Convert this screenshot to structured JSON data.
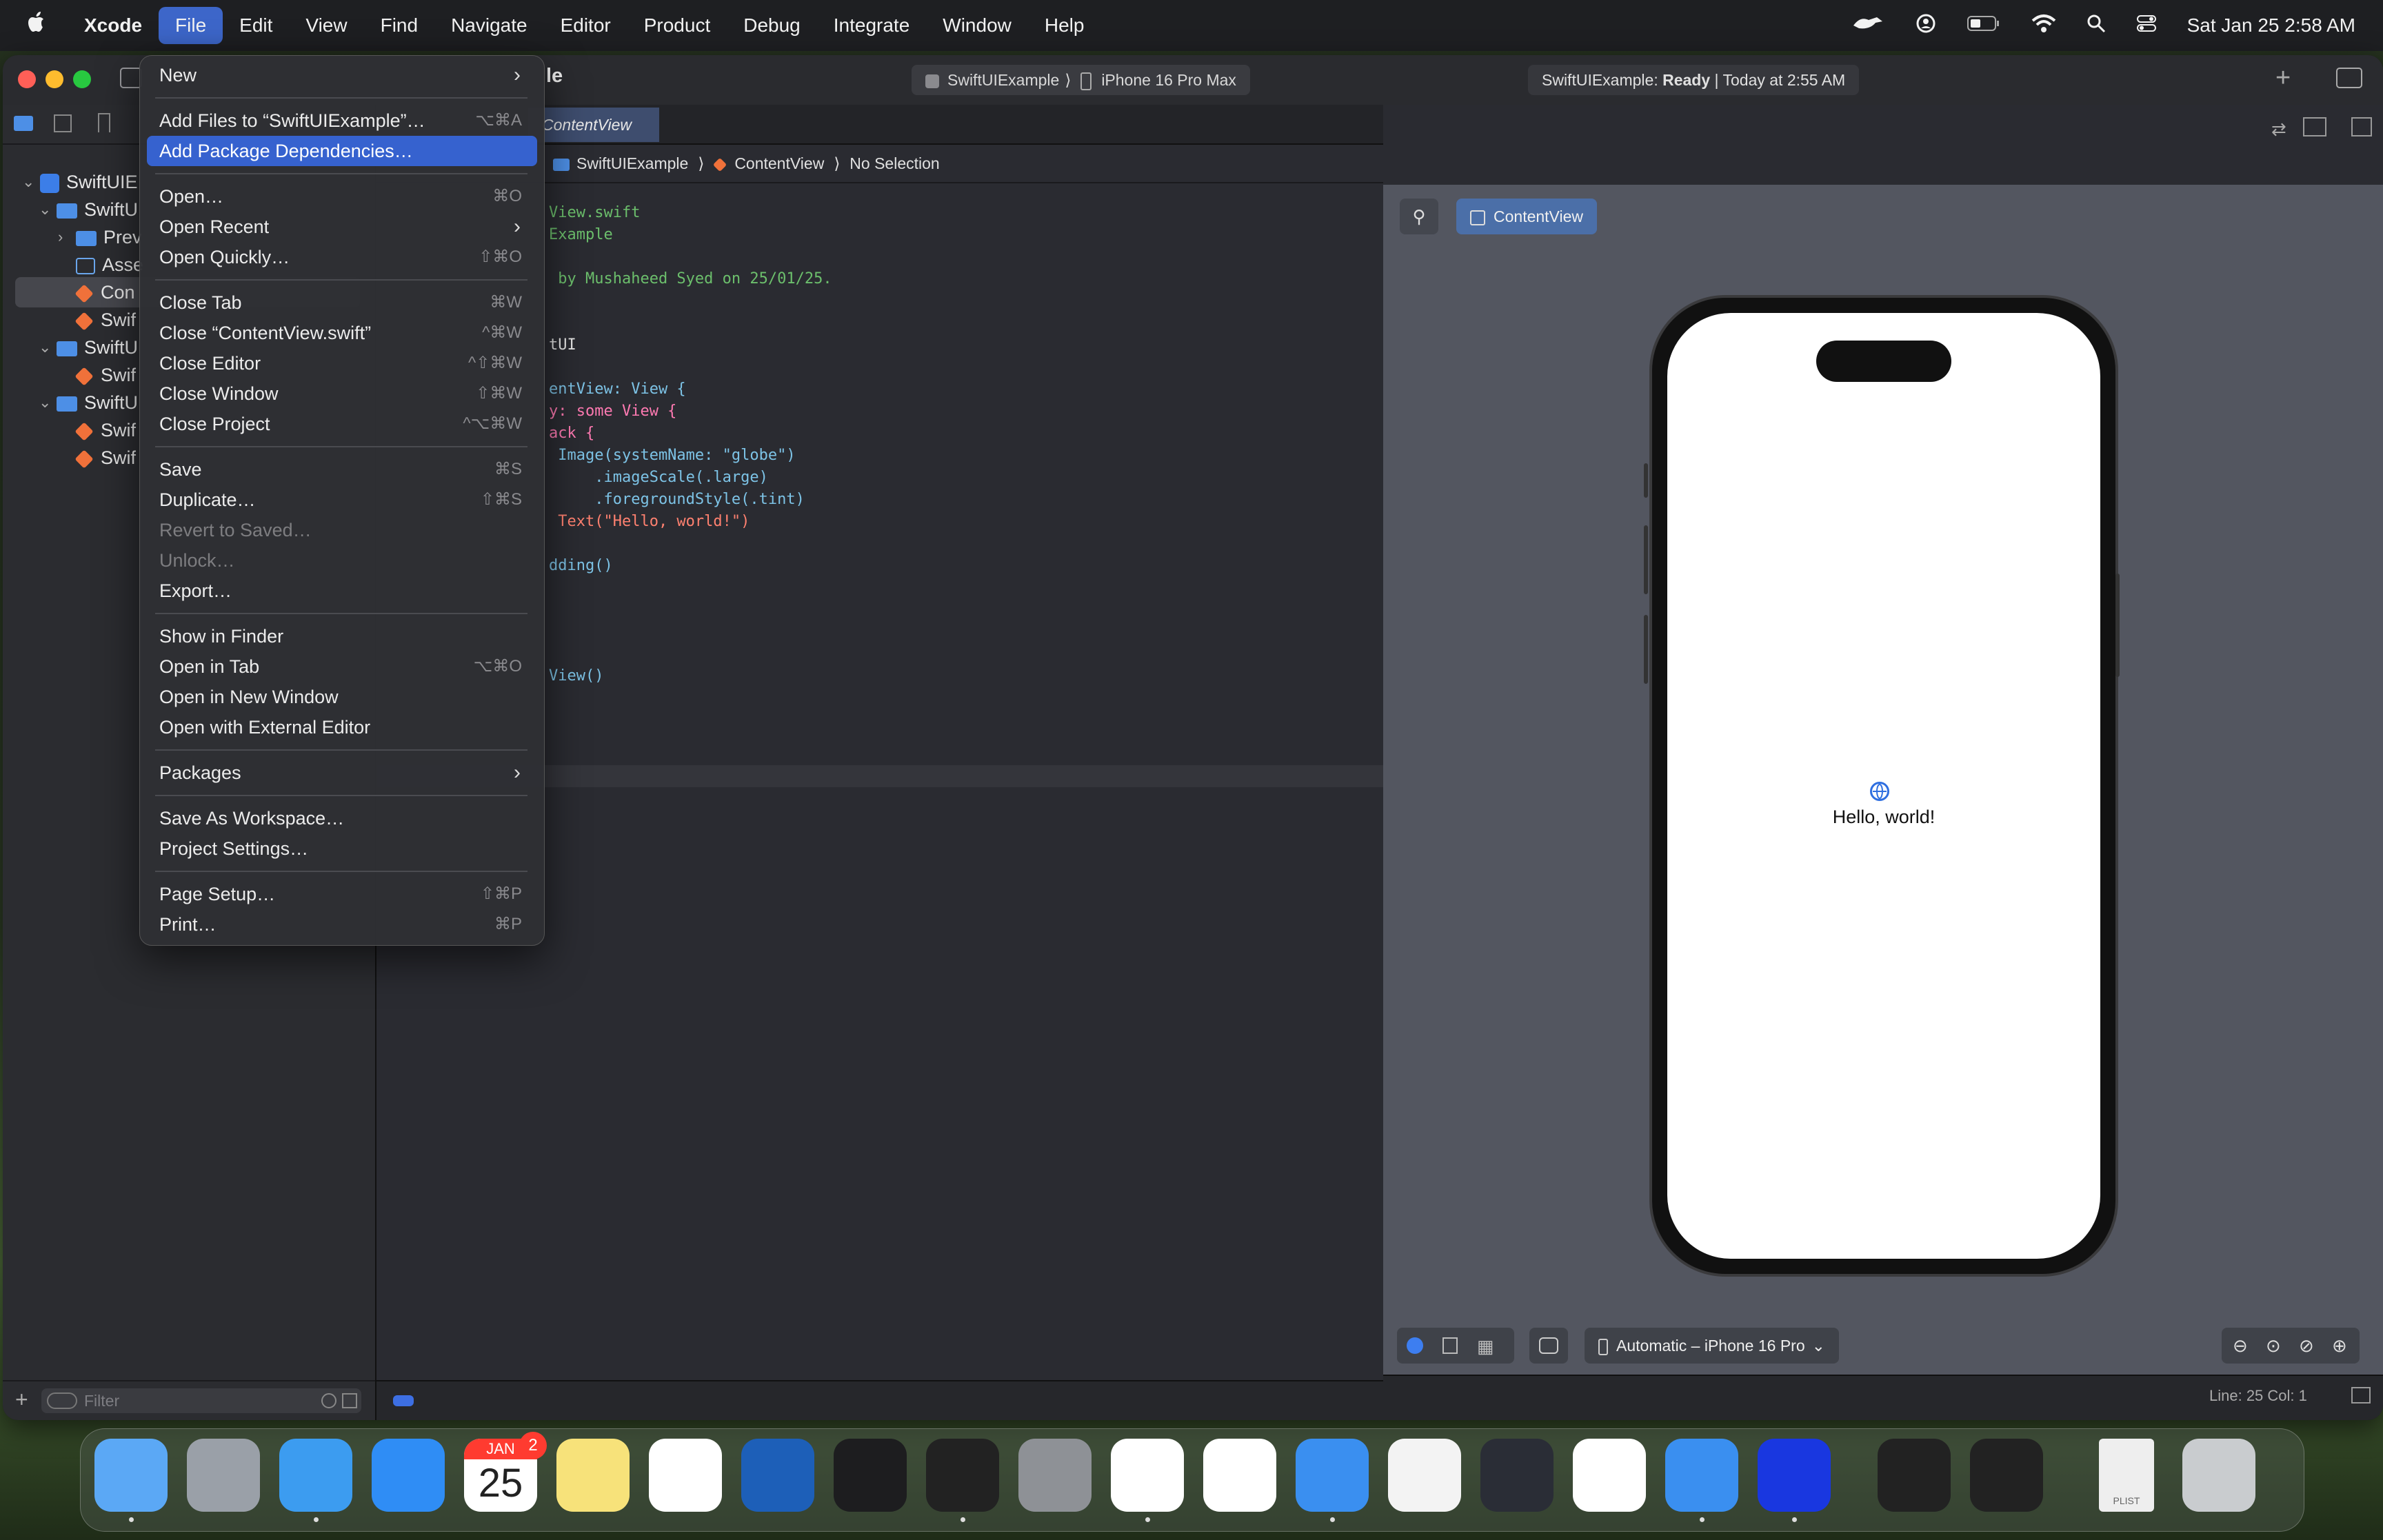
{
  "menubar": {
    "apple": "",
    "app": "Xcode",
    "items": [
      "File",
      "Edit",
      "View",
      "Find",
      "Navigate",
      "Editor",
      "Product",
      "Debug",
      "Integrate",
      "Window",
      "Help"
    ],
    "datetime": "Sat Jan 25  2:58 AM"
  },
  "toolbar": {
    "title_fragment": "le",
    "scheme": "SwiftUIExample",
    "device": "iPhone 16 Pro Max",
    "status_prefix": "SwiftUIExample:",
    "status_state": "Ready",
    "status_time": "| Today at 2:55 AM"
  },
  "editor": {
    "tab": "ContentView",
    "breadcrumb": [
      "SwiftUIExample",
      "ContentView",
      "No Selection"
    ],
    "code": [
      {
        "t": "View.swift",
        "c": "cm"
      },
      {
        "t": "Example",
        "c": "cm"
      },
      {
        "t": "",
        "c": "pl"
      },
      {
        "t": " by Mushaheed Syed on 25/01/25.",
        "c": "cm"
      },
      {
        "t": "",
        "c": "pl"
      },
      {
        "t": "",
        "c": "pl"
      },
      {
        "t": "tUI",
        "c": "pl"
      },
      {
        "t": "",
        "c": "pl"
      },
      {
        "t": "entView: View {",
        "c": "ty"
      },
      {
        "t": "y: some View {",
        "c": "kw"
      },
      {
        "t": "ack {",
        "c": "kw"
      },
      {
        "t": " Image(systemName: \"globe\")",
        "c": "ty"
      },
      {
        "t": "     .imageScale(.large)",
        "c": "ty"
      },
      {
        "t": "     .foregroundStyle(.tint)",
        "c": "ty"
      },
      {
        "t": " Text(\"Hello, world!\")",
        "c": "st"
      },
      {
        "t": "",
        "c": "pl"
      },
      {
        "t": "dding()",
        "c": "ty"
      },
      {
        "t": "",
        "c": "pl"
      },
      {
        "t": "",
        "c": "pl"
      },
      {
        "t": "",
        "c": "pl"
      },
      {
        "t": "",
        "c": "pl"
      },
      {
        "t": "View()",
        "c": "ty"
      }
    ],
    "status_line": "Line: 25  Col: 1"
  },
  "navigator": {
    "items": [
      {
        "label": "SwiftUIE",
        "kind": "project"
      },
      {
        "label": "SwiftU",
        "kind": "folder"
      },
      {
        "label": "Prev",
        "kind": "folder"
      },
      {
        "label": "Asse",
        "kind": "assets"
      },
      {
        "label": "Con",
        "kind": "swift"
      },
      {
        "label": "Swif",
        "kind": "swift"
      },
      {
        "label": "SwiftU",
        "kind": "folder"
      },
      {
        "label": "Swif",
        "kind": "swift"
      },
      {
        "label": "SwiftU",
        "kind": "folder"
      },
      {
        "label": "Swif",
        "kind": "swift"
      },
      {
        "label": "Swif",
        "kind": "swift"
      }
    ],
    "filter_placeholder": "Filter"
  },
  "file_menu": {
    "groups": [
      [
        {
          "label": "New",
          "shortcut": "",
          "submenu": true
        }
      ],
      [
        {
          "label": "Add Files to “SwiftUIExample”…",
          "shortcut": "⌥⌘A"
        },
        {
          "label": "Add Package Dependencies…",
          "shortcut": "",
          "highlighted": true
        }
      ],
      [
        {
          "label": "Open…",
          "shortcut": "⌘O"
        },
        {
          "label": "Open Recent",
          "shortcut": "",
          "submenu": true
        },
        {
          "label": "Open Quickly…",
          "shortcut": "⇧⌘O"
        }
      ],
      [
        {
          "label": "Close Tab",
          "shortcut": "⌘W"
        },
        {
          "label": "Close “ContentView.swift”",
          "shortcut": "^⌘W"
        },
        {
          "label": "Close Editor",
          "shortcut": "^⇧⌘W"
        },
        {
          "label": "Close Window",
          "shortcut": "⇧⌘W"
        },
        {
          "label": "Close Project",
          "shortcut": "^⌥⌘W"
        }
      ],
      [
        {
          "label": "Save",
          "shortcut": "⌘S"
        },
        {
          "label": "Duplicate…",
          "shortcut": "⇧⌘S"
        },
        {
          "label": "Revert to Saved…",
          "shortcut": "",
          "disabled": true
        },
        {
          "label": "Unlock…",
          "shortcut": "",
          "disabled": true
        },
        {
          "label": "Export…",
          "shortcut": ""
        }
      ],
      [
        {
          "label": "Show in Finder",
          "shortcut": ""
        },
        {
          "label": "Open in Tab",
          "shortcut": "⌥⌘O"
        },
        {
          "label": "Open in New Window",
          "shortcut": ""
        },
        {
          "label": "Open with External Editor",
          "shortcut": ""
        }
      ],
      [
        {
          "label": "Packages",
          "shortcut": "",
          "submenu": true
        }
      ],
      [
        {
          "label": "Save As Workspace…",
          "shortcut": ""
        },
        {
          "label": "Project Settings…",
          "shortcut": ""
        }
      ],
      [
        {
          "label": "Page Setup…",
          "shortcut": "⇧⌘P"
        },
        {
          "label": "Print…",
          "shortcut": "⌘P"
        }
      ]
    ]
  },
  "preview": {
    "tab_label": "ContentView",
    "hello_text": "Hello, world!",
    "device_selector": "Automatic – iPhone 16 Pro"
  },
  "dock": {
    "calendar_month": "JAN",
    "calendar_day": "25",
    "calendar_badge": "2",
    "plist_label": "PLIST",
    "apps": [
      {
        "name": "finder-icon",
        "color": "#5ba8f5"
      },
      {
        "name": "launchpad-icon",
        "color": "#9aa0a8"
      },
      {
        "name": "safari-icon",
        "color": "#3c9cf0"
      },
      {
        "name": "app-store-icon",
        "color": "#2f8df5"
      },
      {
        "name": "calendar-icon",
        "color": "#ffffff"
      },
      {
        "name": "notes-icon",
        "color": "#f7e27a"
      },
      {
        "name": "gmail-icon",
        "color": "#ffffff"
      },
      {
        "name": "windows-app-icon",
        "color": "#1d5fb8"
      },
      {
        "name": "terminal-icon",
        "color": "#1d1d1f"
      },
      {
        "name": "unity-icon",
        "color": "#222222"
      },
      {
        "name": "system-settings-icon",
        "color": "#8e9196"
      },
      {
        "name": "slack-icon",
        "color": "#ffffff"
      },
      {
        "name": "chrome-icon",
        "color": "#ffffff"
      },
      {
        "name": "xcode-icon",
        "color": "#3a8ff0"
      },
      {
        "name": "instruments-icon",
        "color": "#f3f3f3"
      },
      {
        "name": "nox-icon",
        "color": "#2a2d36"
      },
      {
        "name": "vscode-icon",
        "color": "#ffffff"
      },
      {
        "name": "xcode-alt-icon",
        "color": "#3a8ff0"
      },
      {
        "name": "proxyman-icon",
        "color": "#1937e0"
      },
      {
        "name": "unity-hub-icon",
        "color": "#222222"
      },
      {
        "name": "unity-hub-2-icon",
        "color": "#222222"
      },
      {
        "name": "plist-file-icon",
        "color": "#eeeeee"
      },
      {
        "name": "trash-icon",
        "color": "#c9cccf"
      }
    ]
  }
}
